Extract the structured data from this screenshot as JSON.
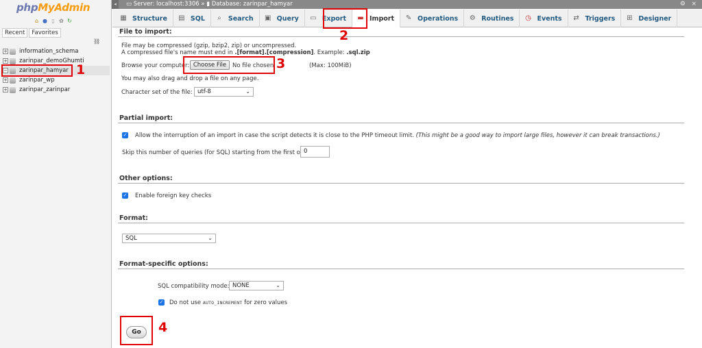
{
  "nav": {
    "logo_php": "php",
    "logo_my": "MyAdmin",
    "tabs": [
      "Recent",
      "Favorites"
    ],
    "databases": [
      {
        "name": "information_schema"
      },
      {
        "name": "zarinpar_demoGhumti"
      },
      {
        "name": "zarinpar_hamyar"
      },
      {
        "name": "zarinpar_wp"
      },
      {
        "name": "zarinpar_zarinpar"
      }
    ]
  },
  "topbar": {
    "server": "Server: localhost:3306",
    "separator": "»",
    "database": "Database: zarinpar_hamyar"
  },
  "tabs": [
    {
      "label": "Structure",
      "icon": "structure-icon"
    },
    {
      "label": "SQL",
      "icon": "sql-icon"
    },
    {
      "label": "Search",
      "icon": "search-icon"
    },
    {
      "label": "Query",
      "icon": "query-icon"
    },
    {
      "label": "Export",
      "icon": "export-icon"
    },
    {
      "label": "Import",
      "icon": "import-icon"
    },
    {
      "label": "Operations",
      "icon": "wrench-icon"
    },
    {
      "label": "Routines",
      "icon": "routines-icon"
    },
    {
      "label": "Events",
      "icon": "events-icon"
    },
    {
      "label": "Triggers",
      "icon": "triggers-icon"
    },
    {
      "label": "Designer",
      "icon": "designer-icon"
    }
  ],
  "file_import": {
    "legend": "File to import:",
    "line1": "File may be compressed (gzip, bzip2, zip) or uncompressed.",
    "line2_a": "A compressed file's name must end in ",
    "line2_b": ".[format].[compression]",
    "line2_c": ". Example: ",
    "line2_d": ".sql.zip",
    "browse_label": "Browse your computer:",
    "choose_file": "Choose File",
    "no_file": "No file chosen",
    "max": "(Max: 100MiB)",
    "drag_drop": "You may also drag and drop a file on any page.",
    "charset_label": "Character set of the file:",
    "charset_value": "utf-8"
  },
  "partial_import": {
    "legend": "Partial import:",
    "allow_interrupt": "Allow the interruption of an import in case the script detects it is close to the PHP timeout limit.",
    "allow_interrupt_note": "(This might be a good way to import large files, however it can break transactions.)",
    "skip_label": "Skip this number of queries (for SQL) starting from the first one:",
    "skip_value": "0"
  },
  "other_options": {
    "legend": "Other options:",
    "foreign_keys": "Enable foreign key checks"
  },
  "format": {
    "legend": "Format:",
    "value": "SQL"
  },
  "format_specific": {
    "legend": "Format-specific options:",
    "compat_label": "SQL compatibility mode:",
    "compat_value": "NONE",
    "auto_inc_a": "Do not use ",
    "auto_inc_b": "AUTO_INCREMENT",
    "auto_inc_c": " for zero values"
  },
  "go_label": "Go",
  "annotations": [
    "1",
    "2",
    "3",
    "4"
  ],
  "colors": {
    "annotation": "#e00000",
    "link": "#235a81",
    "topbar": "#888888"
  }
}
